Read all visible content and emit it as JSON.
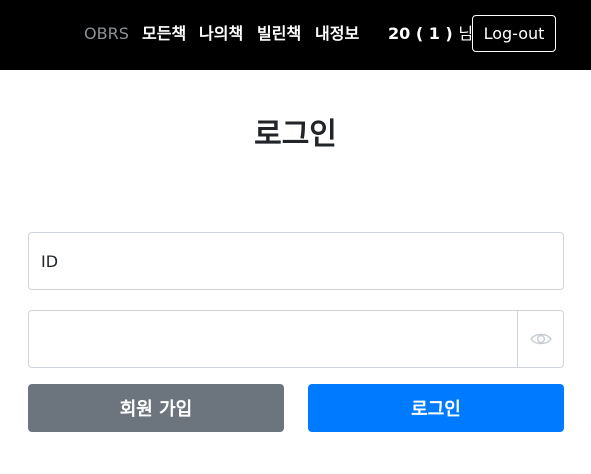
{
  "navbar": {
    "brand": "OBRS",
    "links": [
      "모든책",
      "나의책",
      "빌린책",
      "내정보"
    ],
    "user_text": "20 ( 1 )",
    "user_suffix": "님",
    "logout_label": "Log-out"
  },
  "main": {
    "title": "로그인",
    "id_placeholder": "ID",
    "password_value": "",
    "password_toggle_icon": "eye-icon",
    "signup_label": "회원 가입",
    "login_label": "로그인"
  },
  "colors": {
    "navbar_bg": "#000000",
    "brand": "#8c9196",
    "secondary": "#6c757d",
    "primary": "#007bff",
    "border": "#ced4da"
  }
}
